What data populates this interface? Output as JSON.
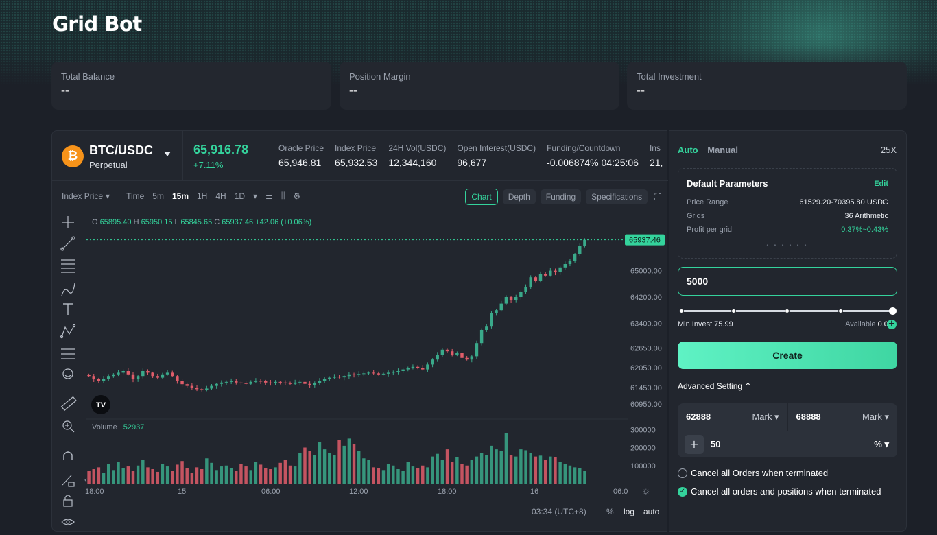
{
  "page": {
    "title": "Grid Bot"
  },
  "stats": [
    {
      "label": "Total Balance",
      "value": "--"
    },
    {
      "label": "Position Margin",
      "value": "--"
    },
    {
      "label": "Total Investment",
      "value": "--"
    }
  ],
  "ticker": {
    "pair": "BTC/USDC",
    "type": "Perpetual",
    "coin_glyph": "₿",
    "last_price": "65,916.78",
    "change": "+7.11%",
    "stats": [
      {
        "label": "Oracle Price",
        "value": "65,946.81"
      },
      {
        "label": "Index Price",
        "value": "65,932.53"
      },
      {
        "label": "24H Vol(USDC)",
        "value": "12,344,160"
      },
      {
        "label": "Open Interest(USDC)",
        "value": "96,677"
      },
      {
        "label": "Funding/Countdown",
        "value": "-0.006874%  04:25:06"
      },
      {
        "label": "Ins",
        "value": "21,"
      }
    ]
  },
  "toolbar": {
    "price_type": "Index Price",
    "intervals": [
      "Time",
      "5m",
      "15m",
      "1H",
      "4H",
      "1D"
    ],
    "active_interval": "15m",
    "views": [
      "Chart",
      "Depth",
      "Funding",
      "Specifications"
    ],
    "active_view": "Chart"
  },
  "chart": {
    "ohlc_o": "65895.40",
    "ohlc_h": "65950.15",
    "ohlc_l": "65845.65",
    "ohlc_c": "65937.46",
    "ohlc_change": "+42.06 (+0.06%)",
    "last_label": "65937.46",
    "volume_label": "Volume",
    "volume_value": "52937",
    "clock": "03:34 (UTC+8)",
    "scale_pct": "%",
    "scale_log": "log",
    "scale_auto": "auto",
    "logo": "TV"
  },
  "chart_data": {
    "type": "candlestick",
    "y_ticks": [
      "65000.00",
      "64200.00",
      "63400.00",
      "62650.00",
      "62050.00",
      "61450.00",
      "60950.00"
    ],
    "x_ticks": [
      "18:00",
      "15",
      "06:00",
      "12:00",
      "18:00",
      "16",
      "06:0"
    ],
    "volume_ticks": [
      "300000",
      "200000",
      "100000"
    ],
    "ylim": [
      60700,
      66200
    ],
    "last_price": 65937.46,
    "volume_max": 320000,
    "closes": [
      61800,
      61700,
      61650,
      61720,
      61800,
      61850,
      61900,
      61950,
      61850,
      61700,
      61800,
      61950,
      61900,
      61800,
      61750,
      61850,
      61900,
      61800,
      61650,
      61550,
      61500,
      61450,
      61400,
      61380,
      61420,
      61500,
      61560,
      61600,
      61620,
      61640,
      61600,
      61580,
      61560,
      61620,
      61650,
      61640,
      61600,
      61580,
      61620,
      61600,
      61580,
      61560,
      61600,
      61620,
      61560,
      61520,
      61580,
      61650,
      61700,
      61750,
      61780,
      61760,
      61800,
      61850,
      61830,
      61860,
      61880,
      61900,
      61880,
      61850,
      61870,
      61900,
      61920,
      61950,
      62000,
      62050,
      62080,
      62050,
      62000,
      62150,
      62300,
      62450,
      62600,
      62550,
      62450,
      62500,
      62350,
      62300,
      62400,
      62800,
      63200,
      63300,
      63700,
      63800,
      64000,
      64200,
      64100,
      64200,
      64350,
      64500,
      64800,
      64700,
      64900,
      64850,
      65000,
      64950,
      65100,
      65200,
      65300,
      65500,
      65750,
      65937
    ],
    "volumes": [
      70000,
      80000,
      90000,
      60000,
      110000,
      75000,
      120000,
      85000,
      95000,
      70000,
      100000,
      130000,
      90000,
      80000,
      65000,
      110000,
      95000,
      70000,
      105000,
      125000,
      85000,
      60000,
      90000,
      80000,
      140000,
      115000,
      75000,
      95000,
      100000,
      85000,
      70000,
      110000,
      95000,
      75000,
      120000,
      105000,
      85000,
      80000,
      90000,
      115000,
      130000,
      100000,
      95000,
      170000,
      200000,
      180000,
      160000,
      230000,
      190000,
      170000,
      160000,
      240000,
      210000,
      250000,
      220000,
      180000,
      140000,
      130000,
      90000,
      85000,
      75000,
      110000,
      100000,
      80000,
      70000,
      120000,
      95000,
      85000,
      100000,
      90000,
      150000,
      165000,
      130000,
      190000,
      120000,
      145000,
      110000,
      100000,
      130000,
      150000,
      170000,
      160000,
      210000,
      190000,
      180000,
      280000,
      160000,
      150000,
      190000,
      185000,
      170000,
      150000,
      155000,
      130000,
      150000,
      145000,
      120000,
      110000,
      100000,
      90000,
      85000,
      70000
    ]
  },
  "create": {
    "tab_auto": "Auto",
    "tab_manual": "Manual",
    "leverage": "25X",
    "params_title": "Default Parameters",
    "edit_label": "Edit",
    "params": [
      {
        "label": "Price Range",
        "value": "61529.20-70395.80 USDC"
      },
      {
        "label": "Grids",
        "value": "36 Arithmetic"
      },
      {
        "label": "Profit per grid",
        "value": "0.37%~0.43%"
      }
    ],
    "pager": "• • • • • •",
    "invest_value": "5000",
    "min_invest": "Min Invest 75.99",
    "available_label": "Available",
    "available_value": "0.00",
    "slider_value": 1.0,
    "create_label": "Create",
    "advanced_label": "Advanced Setting ⌃",
    "lower_price": "62888",
    "upper_price": "68888",
    "price_source": "Mark ▾",
    "percent_value": "50",
    "percent_unit": "% ▾",
    "cancel_orders_label": "Cancel all Orders when terminated",
    "cancel_orders_checked": false,
    "cancel_positions_label": "Cancel all orders and positions when terminated",
    "cancel_positions_checked": true
  },
  "colors": {
    "accent": "#34d39c",
    "down": "#e05d6a",
    "up": "#3aa98a"
  }
}
